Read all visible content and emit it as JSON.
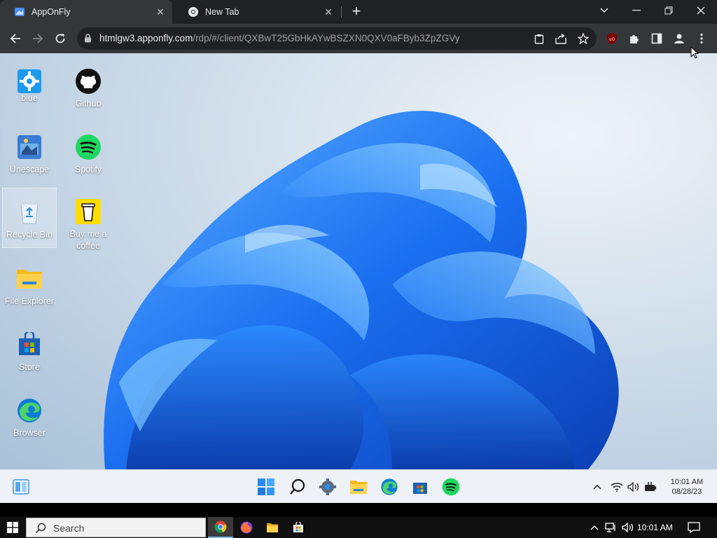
{
  "browser": {
    "tabs": [
      {
        "title": "AppOnFly",
        "active": true
      },
      {
        "title": "New Tab",
        "active": false
      }
    ],
    "url": {
      "host": "htmlgw3.apponfly.com",
      "path": "/rdp/#/client/QXBwT25GbHkAYwBSZXN0QXV0aFByb3ZpZGVy"
    }
  },
  "desktop": {
    "icons": [
      {
        "label": "blue"
      },
      {
        "label": "Github"
      },
      {
        "label": "Unescape"
      },
      {
        "label": "Spotify"
      },
      {
        "label": "Recycle Bin"
      },
      {
        "label": "Buy me a coffee"
      },
      {
        "label": "File Explorer"
      },
      {
        "label": "Store"
      },
      {
        "label": "Browser"
      }
    ]
  },
  "remote_taskbar": {
    "time": "10:01 AM",
    "date": "08/28/23"
  },
  "host_taskbar": {
    "search_placeholder": "Search",
    "time": "10:01 AM"
  },
  "colors": {
    "chrome_dark": "#202124",
    "chrome_toolbar": "#35363a",
    "bloom_blue": "#1a6ff0",
    "spotify_green": "#1ed760",
    "w11_taskbar": "#eef2f7"
  }
}
